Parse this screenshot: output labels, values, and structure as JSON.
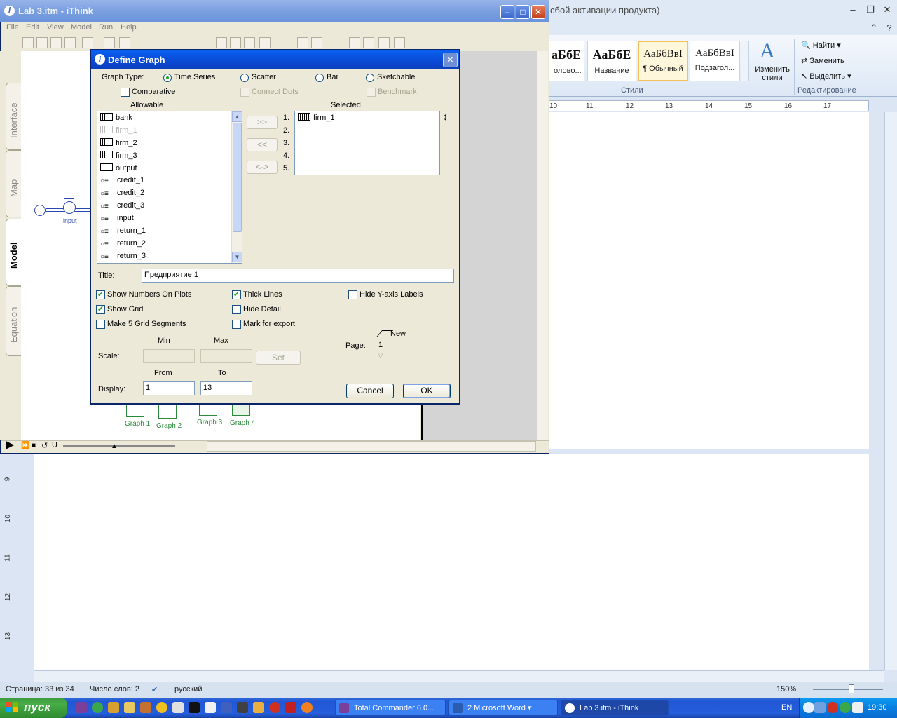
{
  "word": {
    "title_fragment": "сбой активации продукта)",
    "styles": [
      {
        "preview": "аБбЕ",
        "name": "головo..."
      },
      {
        "preview": "АаБбЕ",
        "name": "Название"
      },
      {
        "preview": "АаБбВвI",
        "name": "¶ Обычный"
      },
      {
        "preview": "АаБбВвI",
        "name": "Подзагол..."
      }
    ],
    "change_styles": "Изменить стили",
    "styles_group": "Стили",
    "find": "Найти",
    "replace": "Заменить",
    "select": "Выделить",
    "editing_group": "Редактирование",
    "ruler_numbers": [
      "10",
      "11",
      "12",
      "13",
      "14",
      "15",
      "16",
      "17"
    ],
    "left_ruler_numbers": [
      "9",
      "10",
      "11",
      "12",
      "13"
    ],
    "status": {
      "page": "Страница: 33 из 34",
      "words": "Число слов: 2",
      "language": "русский",
      "zoom": "150%"
    }
  },
  "ithink": {
    "title": "Lab 3.itm - iThink",
    "menu": [
      "File",
      "Edit",
      "View",
      "Model",
      "Run",
      "Help"
    ],
    "tabs": [
      "Interface",
      "Map",
      "Model",
      "Equation"
    ],
    "input_label": "input",
    "graphs": [
      "Graph 1",
      "Graph 2",
      "Graph 3",
      "Graph 4"
    ]
  },
  "dialog": {
    "title": "Define Graph",
    "graph_type_label": "Graph Type:",
    "graph_types": [
      "Time Series",
      "Scatter",
      "Bar",
      "Sketchable"
    ],
    "comparative": "Comparative",
    "connect_dots": "Connect Dots",
    "benchmark": "Benchmark",
    "allowable_label": "Allowable",
    "selected_label": "Selected",
    "allowable": [
      "bank",
      "firm_1",
      "firm_2",
      "firm_3",
      "output",
      "credit_1",
      "credit_2",
      "credit_3",
      "input",
      "return_1",
      "return_2",
      "return_3"
    ],
    "selected": [
      "firm_1"
    ],
    "slot_numbers": [
      "1.",
      "2.",
      "3.",
      "4.",
      "5."
    ],
    "move_buttons": [
      ">>",
      "<<",
      "<->"
    ],
    "title_label": "Title:",
    "title_value": "Предприятие 1",
    "options": {
      "show_numbers": "Show Numbers On Plots",
      "show_grid": "Show Grid",
      "make_5_grid": "Make 5 Grid Segments",
      "thick_lines": "Thick Lines",
      "hide_detail": "Hide Detail",
      "mark_export": "Mark for export",
      "hide_y_labels": "Hide Y-axis Labels"
    },
    "min_label": "Min",
    "max_label": "Max",
    "scale_label": "Scale:",
    "set_button": "Set",
    "page_label": "Page:",
    "page_new": "New",
    "page_value": "1",
    "from_label": "From",
    "to_label": "To",
    "display_label": "Display:",
    "display_from": "1",
    "display_to": "13",
    "cancel": "Cancel",
    "ok": "OK"
  },
  "taskbar": {
    "start": "пуск",
    "tasks": [
      "Total Commander 6.0...",
      "2 Microsoft Word",
      "Lab 3.itm - iThink"
    ],
    "lang": "EN",
    "clock": "19:30"
  }
}
